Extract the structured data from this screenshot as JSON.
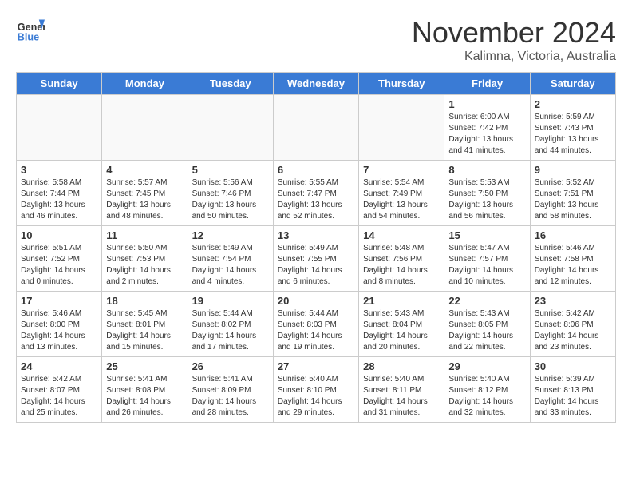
{
  "header": {
    "logo_general": "General",
    "logo_blue": "Blue",
    "month_title": "November 2024",
    "location": "Kalimna, Victoria, Australia"
  },
  "weekdays": [
    "Sunday",
    "Monday",
    "Tuesday",
    "Wednesday",
    "Thursday",
    "Friday",
    "Saturday"
  ],
  "weeks": [
    [
      {
        "day": "",
        "info": ""
      },
      {
        "day": "",
        "info": ""
      },
      {
        "day": "",
        "info": ""
      },
      {
        "day": "",
        "info": ""
      },
      {
        "day": "",
        "info": ""
      },
      {
        "day": "1",
        "info": "Sunrise: 6:00 AM\nSunset: 7:42 PM\nDaylight: 13 hours\nand 41 minutes."
      },
      {
        "day": "2",
        "info": "Sunrise: 5:59 AM\nSunset: 7:43 PM\nDaylight: 13 hours\nand 44 minutes."
      }
    ],
    [
      {
        "day": "3",
        "info": "Sunrise: 5:58 AM\nSunset: 7:44 PM\nDaylight: 13 hours\nand 46 minutes."
      },
      {
        "day": "4",
        "info": "Sunrise: 5:57 AM\nSunset: 7:45 PM\nDaylight: 13 hours\nand 48 minutes."
      },
      {
        "day": "5",
        "info": "Sunrise: 5:56 AM\nSunset: 7:46 PM\nDaylight: 13 hours\nand 50 minutes."
      },
      {
        "day": "6",
        "info": "Sunrise: 5:55 AM\nSunset: 7:47 PM\nDaylight: 13 hours\nand 52 minutes."
      },
      {
        "day": "7",
        "info": "Sunrise: 5:54 AM\nSunset: 7:49 PM\nDaylight: 13 hours\nand 54 minutes."
      },
      {
        "day": "8",
        "info": "Sunrise: 5:53 AM\nSunset: 7:50 PM\nDaylight: 13 hours\nand 56 minutes."
      },
      {
        "day": "9",
        "info": "Sunrise: 5:52 AM\nSunset: 7:51 PM\nDaylight: 13 hours\nand 58 minutes."
      }
    ],
    [
      {
        "day": "10",
        "info": "Sunrise: 5:51 AM\nSunset: 7:52 PM\nDaylight: 14 hours\nand 0 minutes."
      },
      {
        "day": "11",
        "info": "Sunrise: 5:50 AM\nSunset: 7:53 PM\nDaylight: 14 hours\nand 2 minutes."
      },
      {
        "day": "12",
        "info": "Sunrise: 5:49 AM\nSunset: 7:54 PM\nDaylight: 14 hours\nand 4 minutes."
      },
      {
        "day": "13",
        "info": "Sunrise: 5:49 AM\nSunset: 7:55 PM\nDaylight: 14 hours\nand 6 minutes."
      },
      {
        "day": "14",
        "info": "Sunrise: 5:48 AM\nSunset: 7:56 PM\nDaylight: 14 hours\nand 8 minutes."
      },
      {
        "day": "15",
        "info": "Sunrise: 5:47 AM\nSunset: 7:57 PM\nDaylight: 14 hours\nand 10 minutes."
      },
      {
        "day": "16",
        "info": "Sunrise: 5:46 AM\nSunset: 7:58 PM\nDaylight: 14 hours\nand 12 minutes."
      }
    ],
    [
      {
        "day": "17",
        "info": "Sunrise: 5:46 AM\nSunset: 8:00 PM\nDaylight: 14 hours\nand 13 minutes."
      },
      {
        "day": "18",
        "info": "Sunrise: 5:45 AM\nSunset: 8:01 PM\nDaylight: 14 hours\nand 15 minutes."
      },
      {
        "day": "19",
        "info": "Sunrise: 5:44 AM\nSunset: 8:02 PM\nDaylight: 14 hours\nand 17 minutes."
      },
      {
        "day": "20",
        "info": "Sunrise: 5:44 AM\nSunset: 8:03 PM\nDaylight: 14 hours\nand 19 minutes."
      },
      {
        "day": "21",
        "info": "Sunrise: 5:43 AM\nSunset: 8:04 PM\nDaylight: 14 hours\nand 20 minutes."
      },
      {
        "day": "22",
        "info": "Sunrise: 5:43 AM\nSunset: 8:05 PM\nDaylight: 14 hours\nand 22 minutes."
      },
      {
        "day": "23",
        "info": "Sunrise: 5:42 AM\nSunset: 8:06 PM\nDaylight: 14 hours\nand 23 minutes."
      }
    ],
    [
      {
        "day": "24",
        "info": "Sunrise: 5:42 AM\nSunset: 8:07 PM\nDaylight: 14 hours\nand 25 minutes."
      },
      {
        "day": "25",
        "info": "Sunrise: 5:41 AM\nSunset: 8:08 PM\nDaylight: 14 hours\nand 26 minutes."
      },
      {
        "day": "26",
        "info": "Sunrise: 5:41 AM\nSunset: 8:09 PM\nDaylight: 14 hours\nand 28 minutes."
      },
      {
        "day": "27",
        "info": "Sunrise: 5:40 AM\nSunset: 8:10 PM\nDaylight: 14 hours\nand 29 minutes."
      },
      {
        "day": "28",
        "info": "Sunrise: 5:40 AM\nSunset: 8:11 PM\nDaylight: 14 hours\nand 31 minutes."
      },
      {
        "day": "29",
        "info": "Sunrise: 5:40 AM\nSunset: 8:12 PM\nDaylight: 14 hours\nand 32 minutes."
      },
      {
        "day": "30",
        "info": "Sunrise: 5:39 AM\nSunset: 8:13 PM\nDaylight: 14 hours\nand 33 minutes."
      }
    ]
  ]
}
